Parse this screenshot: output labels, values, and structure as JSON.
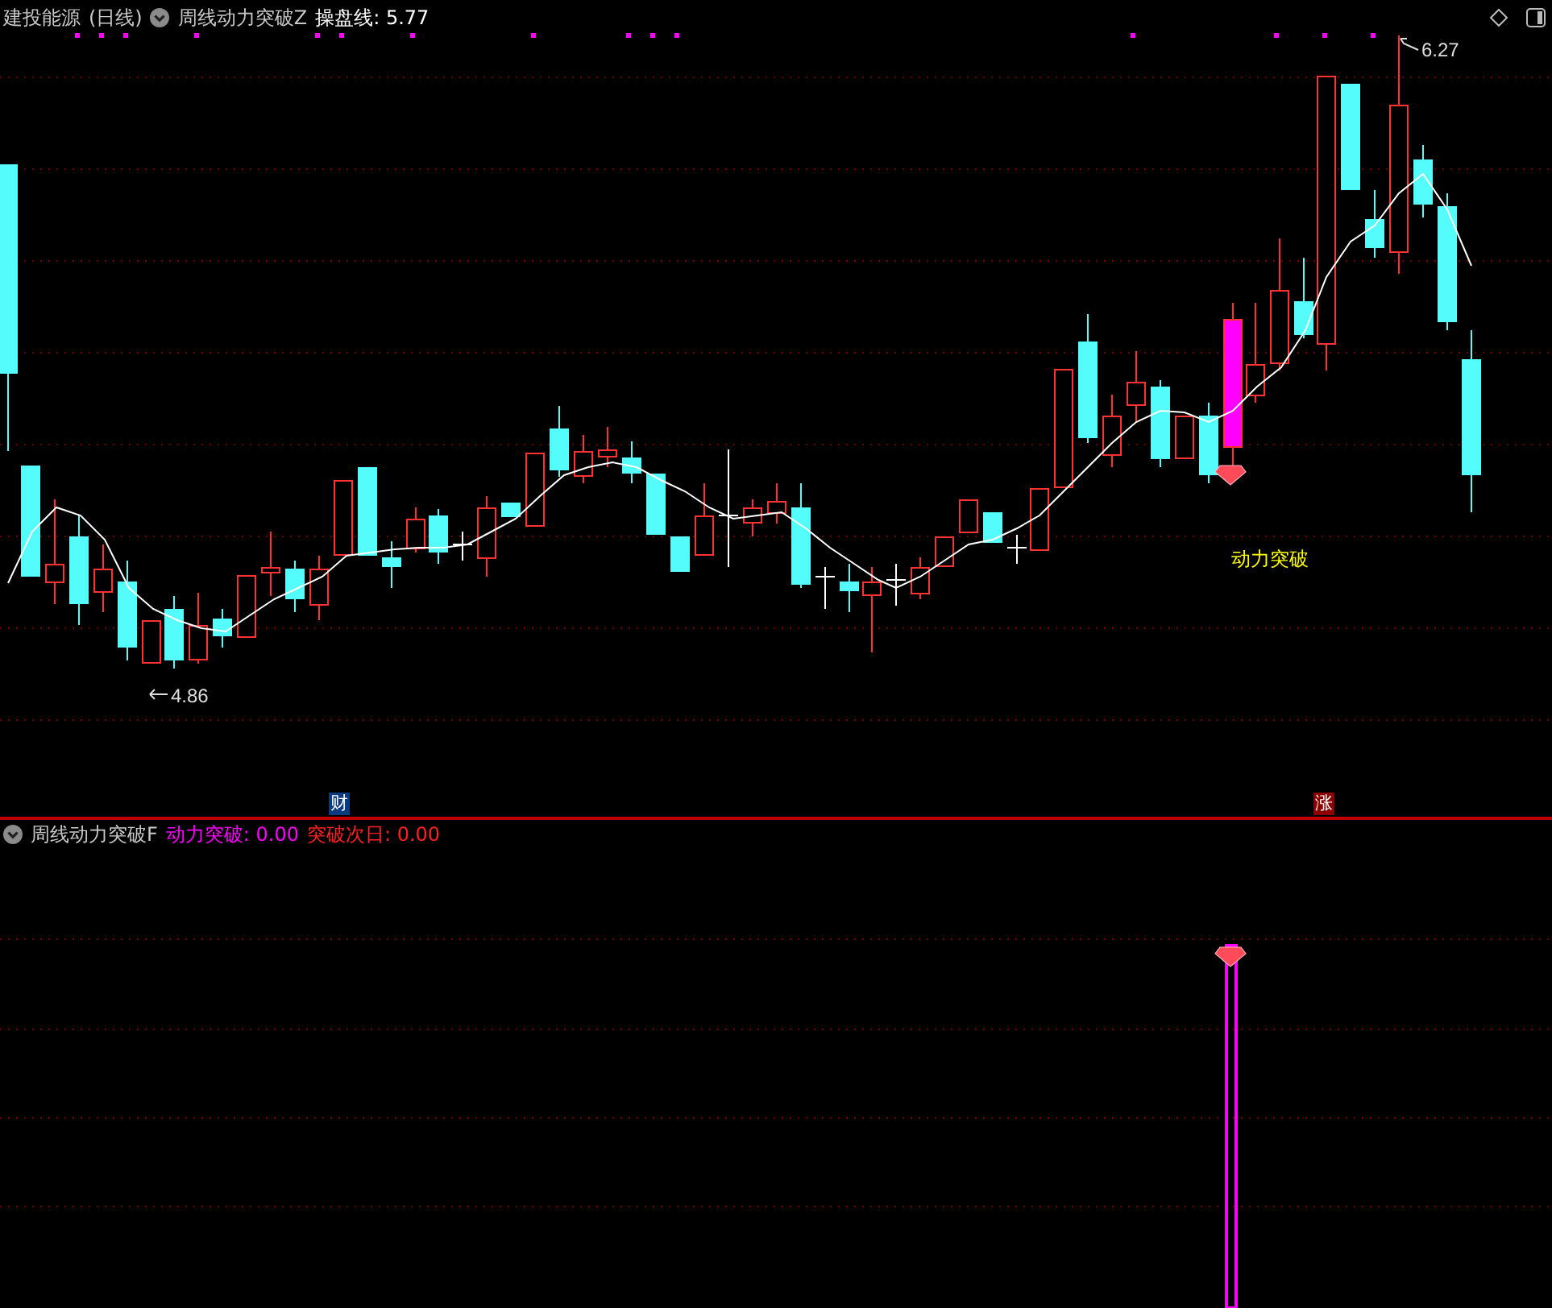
{
  "main_panel": {
    "stock_name": "建投能源",
    "period": "(日线)",
    "indicator": "周线动力突破Z",
    "line_label": "操盘线:",
    "line_value": "5.77",
    "high_label": "6.27",
    "low_label": "4.86",
    "signal_label": "动力突破",
    "badges": [
      {
        "text": "财",
        "kind": "finance"
      },
      {
        "text": "涨",
        "kind": "rise"
      }
    ]
  },
  "sub_panel": {
    "indicator": "周线动力突破F",
    "values": [
      {
        "name": "动力突破:",
        "value": "0.00",
        "color": "#ff00ff"
      },
      {
        "name": "突破次日:",
        "value": "0.00",
        "color": "#ff2020"
      }
    ]
  }
}
